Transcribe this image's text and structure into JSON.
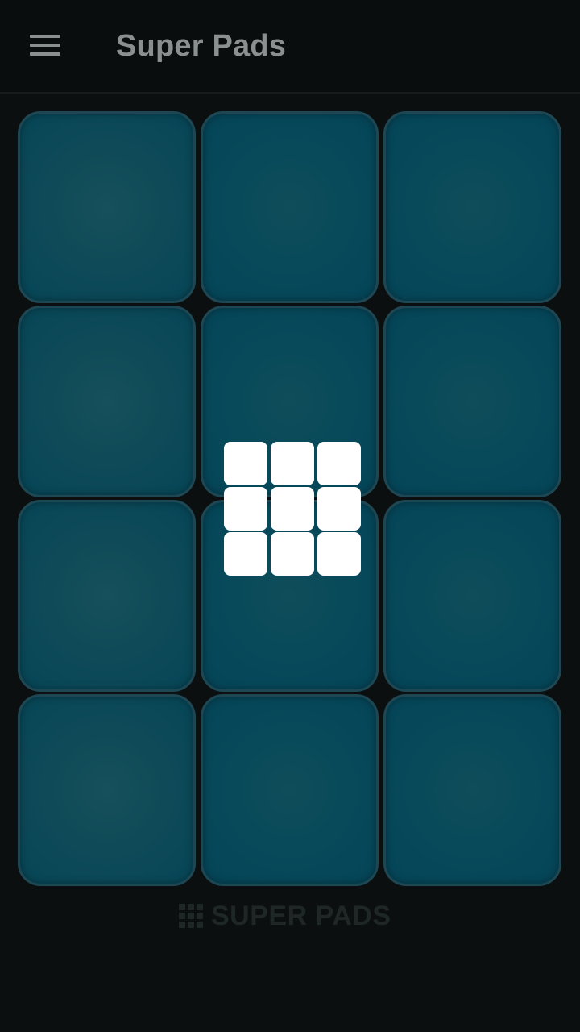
{
  "header": {
    "title": "Super Pads",
    "menu_icon": "hamburger-menu-icon"
  },
  "pads": {
    "rows": 4,
    "cols": 3,
    "color": "#064657",
    "border_color": "#1e4753"
  },
  "overlay": {
    "icon": "grid-3x3-icon",
    "tile_color": "#ffffff"
  },
  "footer": {
    "brand_text": "SUPER PADS",
    "brand_icon": "grid-logo-icon"
  }
}
